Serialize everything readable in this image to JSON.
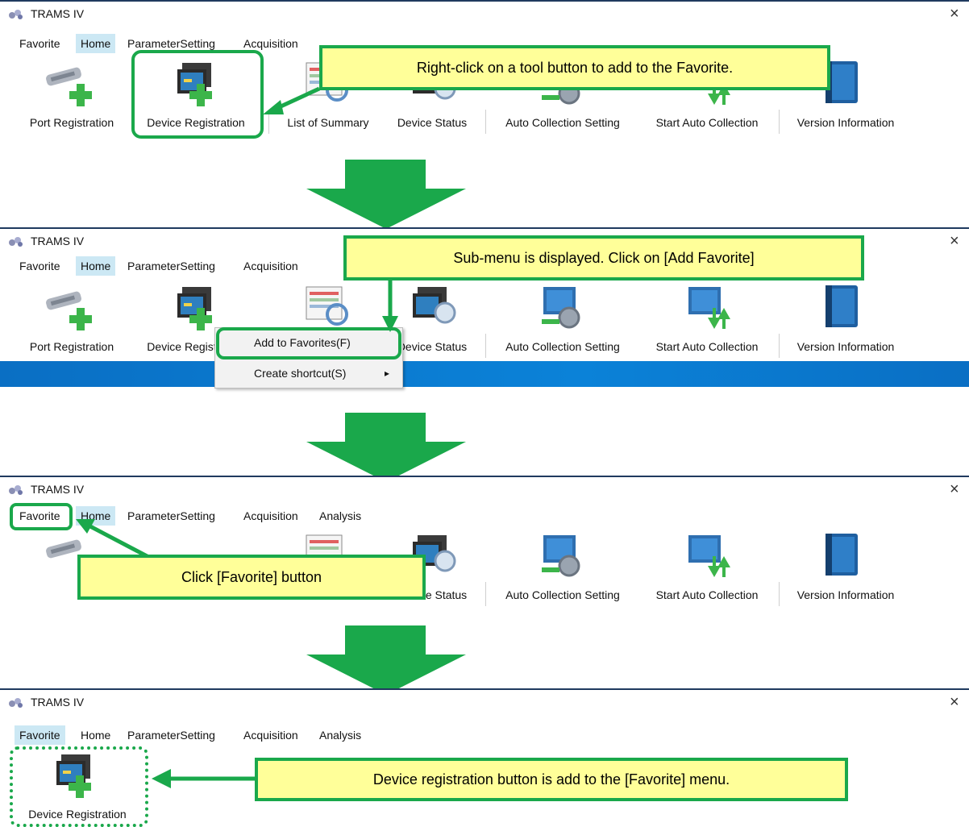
{
  "app": {
    "title": "TRAMS IV",
    "close_glyph": "×"
  },
  "menu": [
    "Favorite",
    "Home",
    "ParameterSetting",
    "Acquisition",
    "Analysis"
  ],
  "ribbon_buttons": [
    "Port Registration",
    "Device Registration",
    "List of Summary",
    "Device Status",
    "Auto Collection Setting",
    "Start Auto Collection",
    "Version Information"
  ],
  "steps": [
    {
      "callout": "Right-click on a tool button to add to the Favorite.",
      "active_menu": "Home"
    },
    {
      "callout": "Sub-menu is displayed. Click on [Add Favorite]",
      "active_menu": "Home",
      "context_menu": [
        "Add to Favorites(F)",
        "Create shortcut(S)"
      ],
      "submenu_arrow": "▸"
    },
    {
      "callout": "Click [Favorite] button",
      "active_menu": "Home"
    },
    {
      "callout": "Device registration button is add to the [Favorite] menu.",
      "active_menu": "Favorite"
    }
  ],
  "colors": {
    "highlight_green": "#1aa84b",
    "callout_fill": "#ffff99",
    "active_menu": "#cce8f4"
  }
}
